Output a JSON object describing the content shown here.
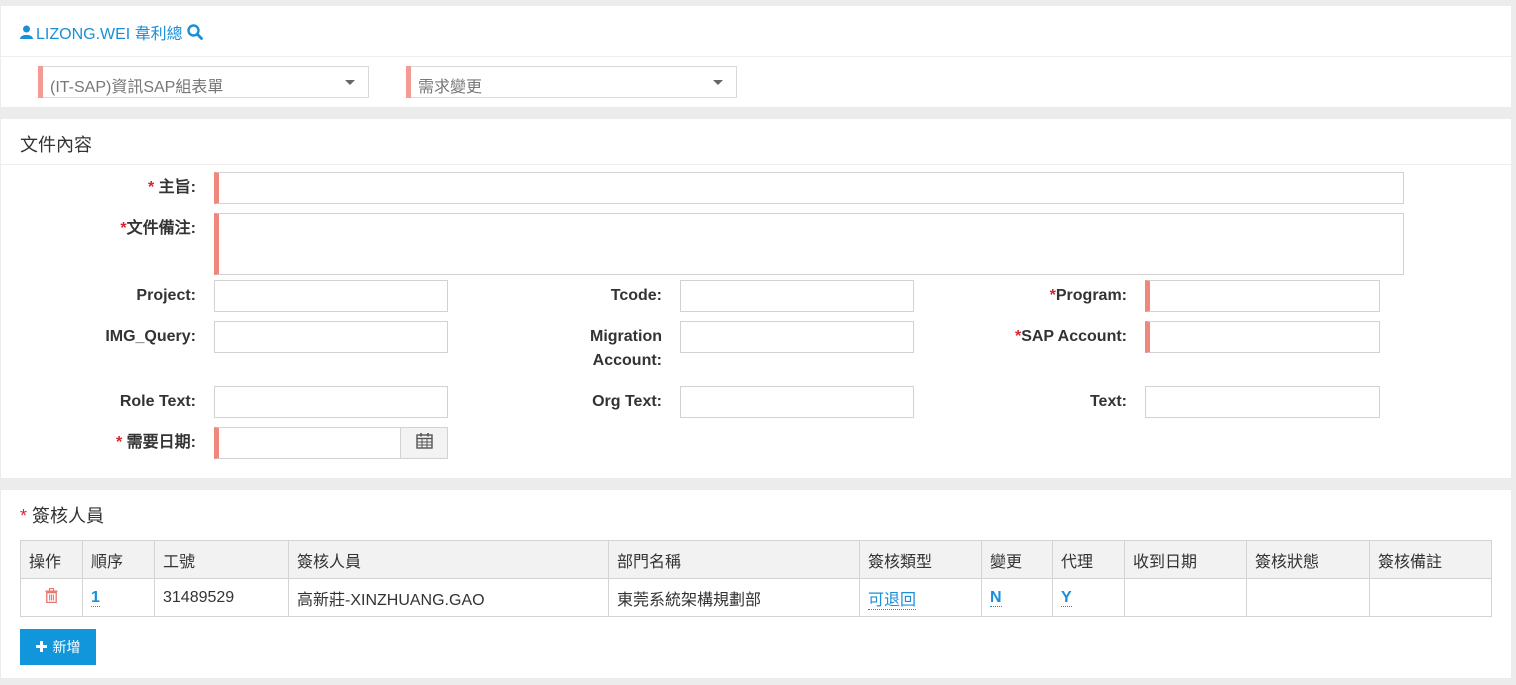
{
  "header": {
    "user_name": "LIZONG.WEI 韋利總",
    "form_category": "(IT-SAP)資訊SAP組表單",
    "form_type": "需求變更"
  },
  "content_section": {
    "title": "文件內容",
    "fields": {
      "subject_label": "主旨:",
      "remark_label": "文件備注:",
      "project_label": "Project:",
      "tcode_label": "Tcode:",
      "program_label": "Program:",
      "img_query_label": "IMG_Query:",
      "migration_label_1": "Migration",
      "migration_label_2": "Account:",
      "sap_account_label": "SAP Account:",
      "role_text_label": "Role Text:",
      "org_text_label": "Org Text:",
      "text_label": "Text:",
      "required_date_label": "需要日期:"
    }
  },
  "approvers_section": {
    "title": "簽核人員",
    "columns": [
      "操作",
      "順序",
      "工號",
      "簽核人員",
      "部門名稱",
      "簽核類型",
      "變更",
      "代理",
      "收到日期",
      "簽核狀態",
      "簽核備註"
    ],
    "rows": [
      {
        "order": "1",
        "employee_id": "31489529",
        "approver": "高新莊-XINZHUANG.GAO",
        "department": "東莞系統架構規劃部",
        "sign_type": "可退回",
        "change": "N",
        "proxy": "Y",
        "received_date": "",
        "status": "",
        "note": ""
      }
    ],
    "add_button": "新增"
  },
  "colors": {
    "accent": "#1a8fd8",
    "required_bar": "#f0877c",
    "required_star": "#d9232d",
    "button": "#1296db"
  }
}
